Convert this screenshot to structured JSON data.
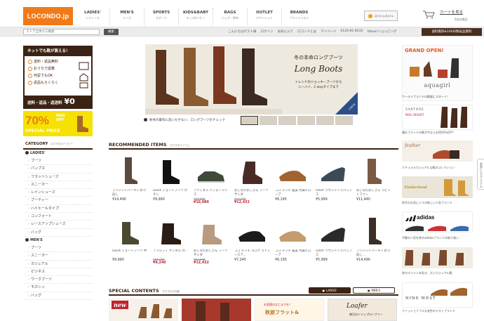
{
  "header": {
    "logo": "LOCONDO.jp",
    "nav": [
      {
        "en": "LADIES'",
        "jp": "レディース"
      },
      {
        "en": "MEN'S",
        "jp": "メンズ"
      },
      {
        "en": "SPORTS",
        "jp": "スポーツ"
      },
      {
        "en": "KIDS&BABY",
        "jp": "キッズ&ベビー"
      },
      {
        "en": "BAGS",
        "jp": "バッグ・財布"
      },
      {
        "en": "OUTLET",
        "jp": "アウトレット"
      },
      {
        "en": "BRANDS",
        "jp": "ブランドリスト"
      }
    ],
    "concierge": "コンシェルジュ",
    "cart_label": "カートを見る",
    "cart_count": "0点の商品"
  },
  "search": {
    "placeholder": "ストア全体から検索",
    "button": "検索",
    "links": [
      "こんにちはゲスト様",
      "ログイン",
      "お気に入り",
      "ロコンドとは",
      "マイページ",
      "0120-81-8510",
      "Yahoo!ショッピング"
    ],
    "free_shipping": "送料無料&100日間返品無料"
  },
  "promo": {
    "head": "ネットでも靴が買える！",
    "items": [
      "送料・返品無料",
      "おうちで試着",
      "何足でもOK",
      "返品もらくらく"
    ],
    "foot": "送料・返品・返送料",
    "foot_yen": "¥0"
  },
  "sale": {
    "pct": "70%",
    "max": "MAX\nOFF",
    "special": "SPECIAL PRICE"
  },
  "category": {
    "title": "CATEGORY",
    "subtitle": "おすすめカテゴリー",
    "ladies_label": "LADIES'",
    "ladies": [
      "ブーツ",
      "パンプス",
      "フラットシューズ",
      "スニーカー",
      "レインシューズ",
      "ブーティー",
      "ハイヒールタイプ",
      "コンフォート",
      "レースアップシューズ",
      "バッグ"
    ],
    "mens_label": "MEN'S",
    "mens": [
      "ブーツ",
      "スニーカー",
      "カジュアル",
      "ビジネス",
      "ワークブーツ",
      "モカシン",
      "バッグ"
    ]
  },
  "banner": {
    "title": "冬の本命ロングブーツ",
    "script": "Long Boots",
    "sub": "トレンドのジョッキーブーツから\nニーハイ、2 wayタイプまで",
    "check": "CHECK",
    "caption": "秋冬の最旬に追いだせない、ロングブーツをチェック"
  },
  "recommended": {
    "title": "RECOMMENDED ITEMS",
    "subtitle": "おすすめアイテム",
    "row1": [
      {
        "name": "ブリジットバーキン 折り返し",
        "price": "¥14,490"
      },
      {
        "name": "GEOX ショートブーツ ボタン",
        "price": "¥9,990"
      },
      {
        "name": "アディダス パフォーマンス",
        "old": "¥10,000",
        "sale": "¥10,080"
      },
      {
        "name": "おしなだおしきん ブーツサンダ",
        "old": "¥13,240",
        "sale": "¥12,432"
      },
      {
        "name": "ココ チッチ 履美 付属ヒロープ",
        "price": "¥6,195"
      },
      {
        "name": "SOUP ラウンドトゥパンプス",
        "price": "¥5,999"
      },
      {
        "name": "おしなだおしきん ラビットファー",
        "price": "¥11,440"
      }
    ],
    "row2": [
      {
        "name": "GEOX ショートブーツ 中",
        "price": "¥9,990"
      },
      {
        "name": "アマルフィ サンダル 外…",
        "old": "¥16,320",
        "sale": "¥9,240"
      },
      {
        "name": "おしなだおしきん ブーツサンダ",
        "old": "¥13,240",
        "sale": "¥12,432"
      },
      {
        "name": "ココ チッチ ユスケ ミドレースア…",
        "price": "¥7,245"
      },
      {
        "name": "ココ チッチ 履美 付属ヒロープ",
        "price": "¥6,195"
      },
      {
        "name": "SOUP ラウンドトゥパンプス",
        "price": "¥5,999"
      },
      {
        "name": "ブリジットバーキン 折り返し…",
        "price": "¥14,490"
      }
    ]
  },
  "special": {
    "title": "SPECIAL CONTENTS",
    "subtitle": "おすすめの特集",
    "tab_ladies": "LADIES'",
    "tab_mens": "MEN'S",
    "tile1_badge": "new",
    "tile3_small": "お洒落のはじまりを！",
    "tile3_big": "秋旅フラット&",
    "tile4_title": "Loafer",
    "tile4_sub": "毎日のトリップローファー"
  },
  "right": {
    "grand": "GRAND OPEN!",
    "grand_brand": "aquagirl",
    "grand_cap": "ワールドブランドの靴屋にスタート！",
    "sartore": "SARTORE",
    "sartore_off": "MAX 30%OFF",
    "sartore_cap": "憧れブランドの靴が今ならお得30%OFF！",
    "feather": "feather",
    "feather_cap": "ナチュラルカジュアルな靴のコレクション",
    "timb": "Timberland",
    "timb_cap": "秋冬のお気に入りの新しい人気ブランド",
    "adidas": "adidas",
    "adidas_cap": "不動の人気を誇るadidasブランドの取り扱い",
    "slim_cap": "秋のオシャレを彩る、大人カジュアル靴",
    "ninew": "NINE WEST",
    "ninew_cap": "ファッショナブルな女性のマストブランド",
    "side_tab": "お気に入りアイテム"
  }
}
